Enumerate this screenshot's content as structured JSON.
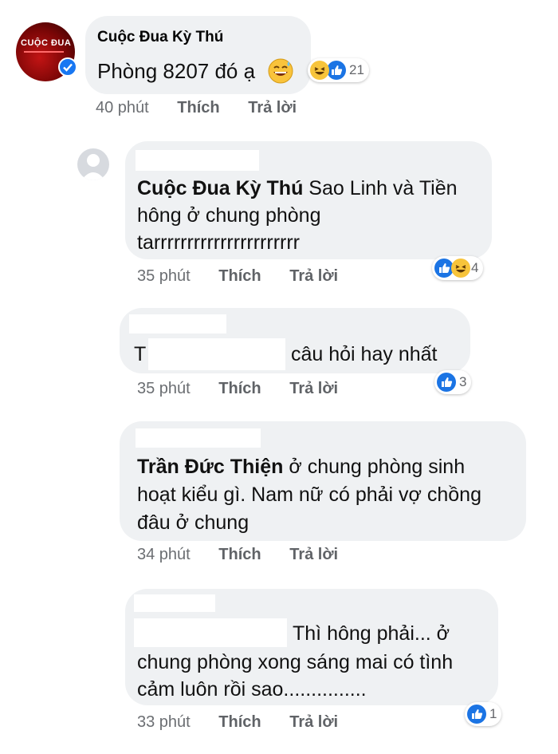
{
  "comments": [
    {
      "author": "Cuộc Đua Kỳ Thú",
      "text": "Phòng 8207 đó ạ",
      "time": "40 phút",
      "like_label": "Thích",
      "reply_label": "Trả lời",
      "reaction_count": "21",
      "avatar_text": "CUỘC ĐUA"
    },
    {
      "mention": "Cuộc Đua Kỳ Thú",
      "line1": "Sao Linh và Tiền",
      "line2": "hông ở chung phòng",
      "line3": "tarrrrrrrrrrrrrrrrrrrrrr",
      "time": "35 phút",
      "like_label": "Thích",
      "reply_label": "Trả lời",
      "reaction_count": "4"
    },
    {
      "prefix": "T",
      "suffix": "câu hỏi hay nhất",
      "time": "35 phút",
      "like_label": "Thích",
      "reply_label": "Trả lời",
      "reaction_count": "3"
    },
    {
      "mention": "Trần Đức Thiện",
      "line1": "ở chung phòng sinh",
      "line2": "hoạt kiểu gì. Nam nữ có phải vợ chồng",
      "line3": "đâu ở chung",
      "time": "34 phút",
      "like_label": "Thích",
      "reply_label": "Trả lời"
    },
    {
      "line1": "Thì hông phải... ở",
      "line2": "chung phòng xong sáng mai có tình",
      "line3": "cảm luôn rồi sao...............",
      "time": "33 phút",
      "like_label": "Thích",
      "reply_label": "Trả lời",
      "reaction_count": "1"
    }
  ],
  "colors": {
    "bubble": "#eff1f3",
    "like_blue": "#1b74e4",
    "haha_yellow": "#f7c43b",
    "verified": "#1877f2",
    "avatar_red": "#8b0a0a"
  }
}
